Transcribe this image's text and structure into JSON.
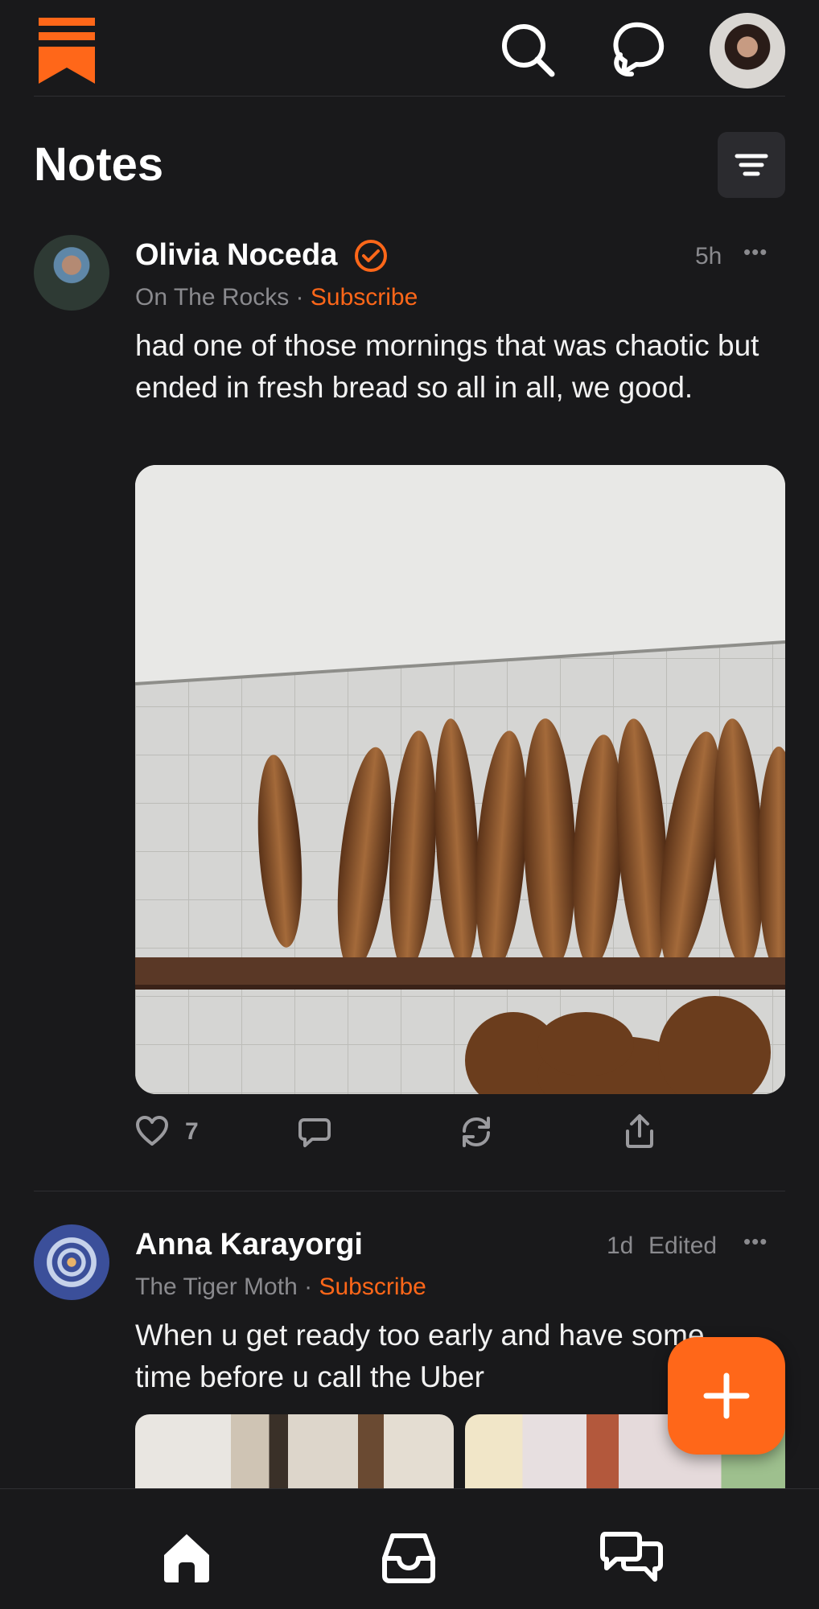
{
  "header": {
    "title": "Notes"
  },
  "notes": [
    {
      "author": "Olivia Noceda",
      "publication": "On The Rocks",
      "separator": "·",
      "subscribe": "Subscribe",
      "time": "5h",
      "body": "had one of those mornings that was chaotic but ended in fresh bread so all in all, we good.",
      "likes": "7"
    },
    {
      "author": "Anna Karayorgi",
      "publication": "The Tiger Moth",
      "separator": "·",
      "subscribe": "Subscribe",
      "time": "1d",
      "edited": "Edited",
      "body": "When u get ready too early and have some time before u call the Uber"
    }
  ],
  "more_label": "•••",
  "colors": {
    "background": "#19191b",
    "accent": "#ff6719",
    "muted": "#8a8a8e"
  },
  "icons": [
    "substack-logo-icon",
    "search-icon",
    "chat-bubbles-icon",
    "profile-avatar",
    "filter-icon",
    "verified-badge-icon",
    "heart-icon",
    "comment-icon",
    "restack-icon",
    "share-icon",
    "plus-icon",
    "home-icon",
    "inbox-icon",
    "chat-icon"
  ]
}
